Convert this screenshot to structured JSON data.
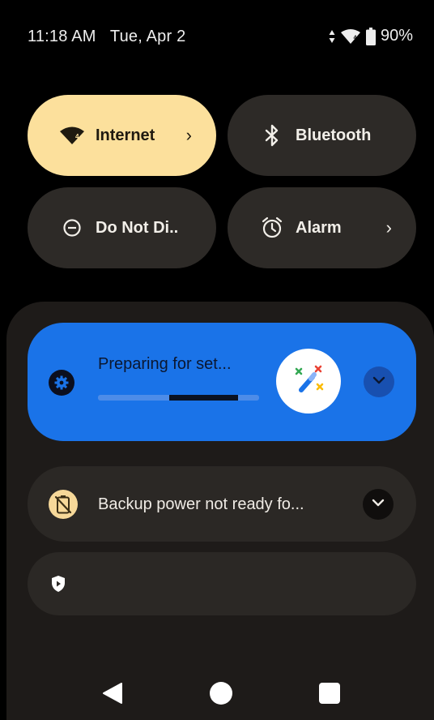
{
  "status_bar": {
    "time": "11:18 AM",
    "date": "Tue, Apr 2",
    "battery_percent": "90%",
    "icons": [
      "data-arrows-icon",
      "wifi-4-icon",
      "battery-icon"
    ]
  },
  "quick_settings": {
    "tiles": [
      {
        "label": "Internet",
        "icon": "wifi-4-icon",
        "active": true,
        "has_chevron": true
      },
      {
        "label": "Bluetooth",
        "icon": "bluetooth-icon",
        "active": false,
        "has_chevron": false
      },
      {
        "label": "Do Not Di..",
        "icon": "do-not-disturb-icon",
        "active": false,
        "has_chevron": false
      },
      {
        "label": "Alarm",
        "icon": "alarm-icon",
        "active": false,
        "has_chevron": true
      }
    ],
    "chevron": "›"
  },
  "notifications": {
    "setup": {
      "title": "Preparing for set...",
      "progress_indeterminate_segment": {
        "start": 0.44,
        "end": 0.87
      },
      "icon": "gear-icon",
      "badge": "magic-wand-icon"
    },
    "backup": {
      "text": "Backup power not ready fo...",
      "icon": "battery-alert-icon"
    },
    "shield": {
      "icon": "shield-play-icon"
    }
  },
  "colors": {
    "tile_active": "#fce09c",
    "tile_inactive": "#2d2a27",
    "setup_notification": "#1a73e8",
    "shade": "#1e1b19"
  },
  "nav": [
    "back-icon",
    "home-icon",
    "recents-icon"
  ]
}
